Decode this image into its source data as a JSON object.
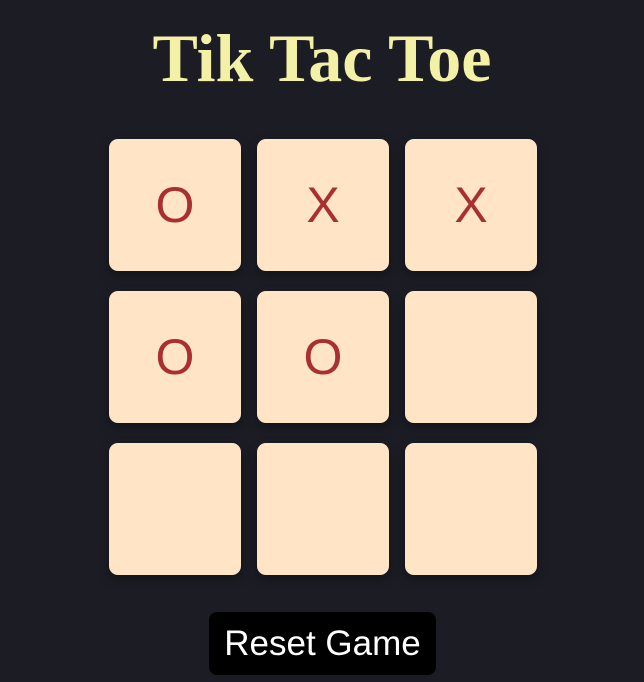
{
  "title": "Tik Tac Toe",
  "board": {
    "cells": [
      "O",
      "X",
      "X",
      "O",
      "O",
      "",
      "",
      "",
      ""
    ]
  },
  "reset_label": "Reset Game",
  "colors": {
    "background": "#1c1c25",
    "title": "#f3f1a6",
    "cell": "#ffe4c5",
    "mark": "#a8312f",
    "button": "#000000",
    "button_text": "#ffffff"
  }
}
